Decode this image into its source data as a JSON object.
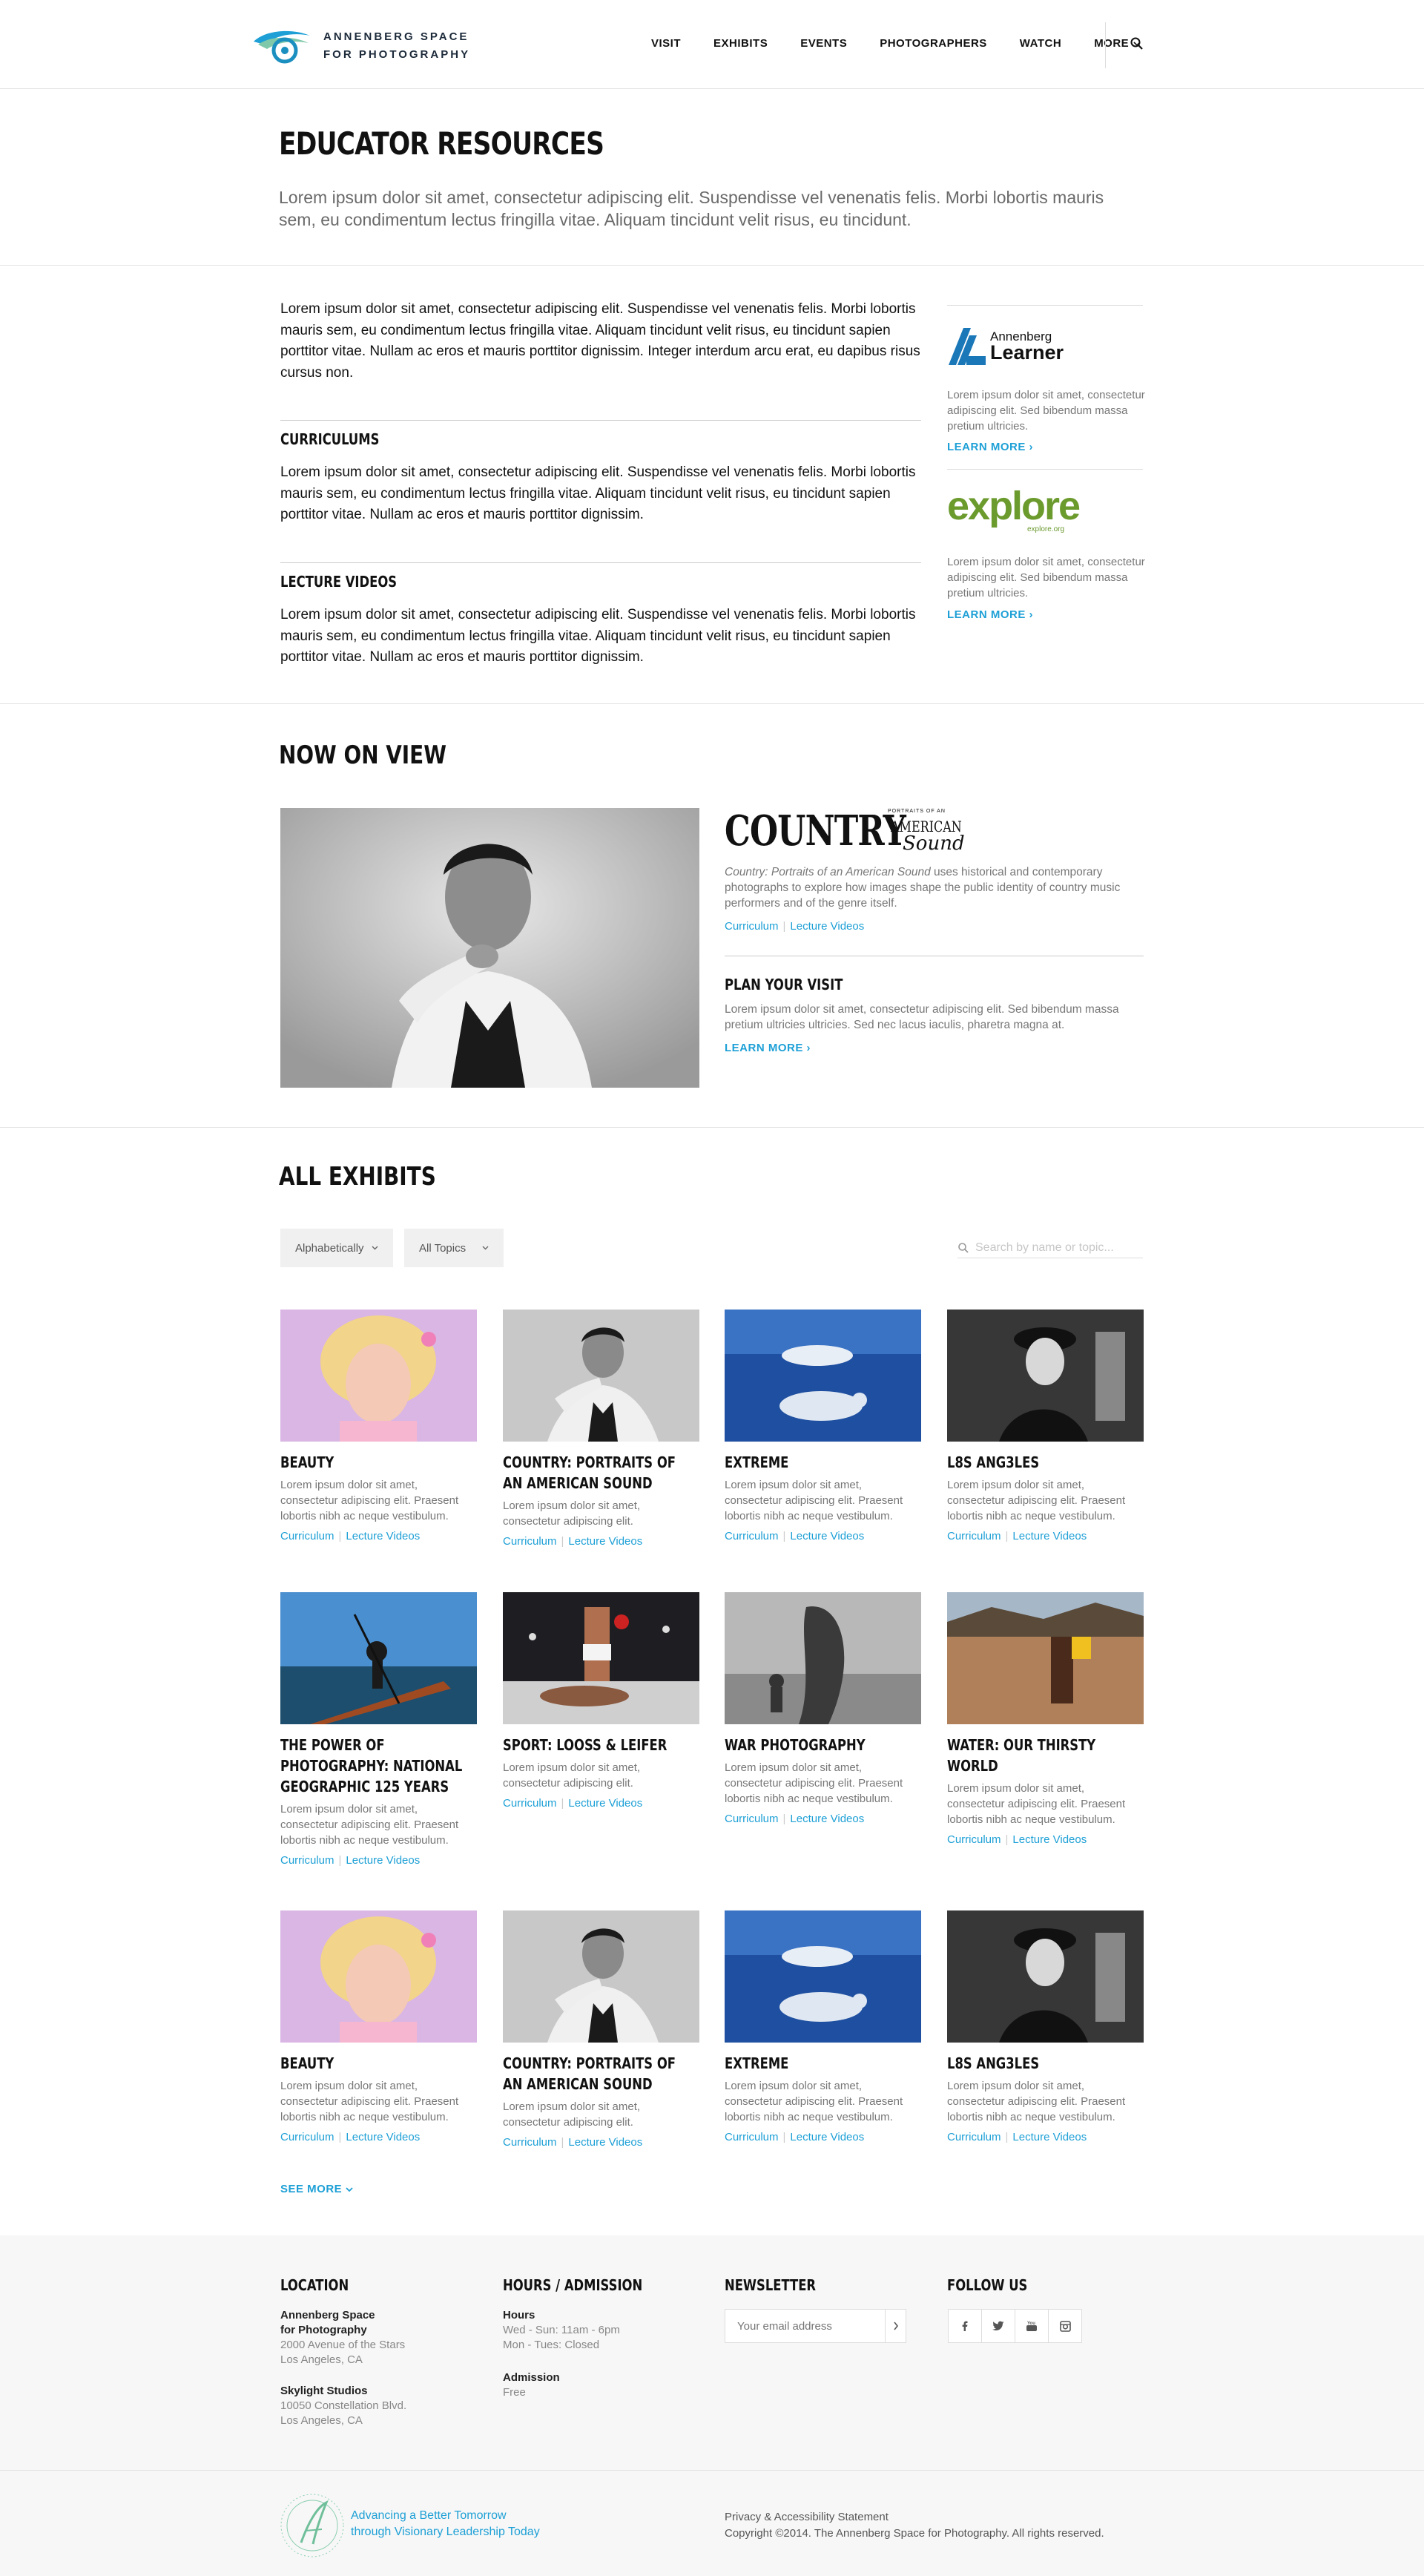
{
  "header": {
    "logo_line1": "Annenberg Space",
    "logo_line2": "for Photography",
    "nav": [
      "VISIT",
      "EXHIBITS",
      "EVENTS",
      "PHOTOGRAPHERS",
      "WATCH",
      "MORE"
    ],
    "search_icon": "search-icon"
  },
  "intro": {
    "title": "EDUCATOR RESOURCES",
    "text": "Lorem ipsum dolor sit amet, consectetur adipiscing elit. Suspendisse vel venenatis felis. Morbi lobortis mauris sem, eu condimentum lectus fringilla vitae. Aliquam tincidunt velit risus, eu tincidunt."
  },
  "resources": {
    "body": "Lorem ipsum dolor sit amet, consectetur adipiscing elit. Suspendisse vel venenatis felis. Morbi lobortis mauris sem, eu condimentum lectus fringilla vitae. Aliquam tincidunt velit risus, eu tincidunt sapien porttitor vitae. Nullam ac eros et mauris porttitor dignissim. Integer interdum arcu erat, eu dapibus risus cursus non.",
    "curriculums_title": "CURRICULUMS",
    "curriculums_text": "Lorem ipsum dolor sit amet, consectetur adipiscing elit. Suspendisse vel venenatis felis. Morbi lobortis mauris sem, eu condimentum lectus fringilla vitae. Aliquam tincidunt velit risus, eu tincidunt sapien porttitor vitae. Nullam ac eros et mauris porttitor dignissim.",
    "lectures_title": "LECTURE VIDEOS",
    "lectures_text": "Lorem ipsum dolor sit amet, consectetur adipiscing elit. Suspendisse vel venenatis felis. Morbi lobortis mauris sem, eu condimentum lectus fringilla vitae. Aliquam tincidunt velit risus, eu tincidunt sapien porttitor vitae. Nullam ac eros et mauris porttitor dignissim.",
    "sidebar": [
      {
        "logo_top": "Annenberg",
        "logo_bottom": "Learner",
        "text": "Lorem ipsum dolor sit amet, consectetur adipiscing elit. Sed bibendum massa pretium ultricies.",
        "link": "LEARN MORE ›"
      },
      {
        "logo": "explore",
        "logo_sub": "explore.org",
        "text": "Lorem ipsum dolor sit amet, consectetur adipiscing elit. Sed bibendum massa pretium ultricies.",
        "link": "LEARN MORE ›"
      }
    ]
  },
  "now_on_view": {
    "title": "NOW ON VIEW",
    "logo_main": "COUNTRY",
    "logo_small": "PORTRAITS OF AN",
    "logo_american": "AMERICAN",
    "logo_sound": "Sound",
    "desc_italic": "Country: Portraits of an American Sound",
    "desc_rest": " uses historical and contemporary photographs to explore how images shape the public identity of country music performers and of the genre itself.",
    "link1": "Curriculum",
    "link2": "Lecture Videos",
    "plan_title": "PLAN YOUR VISIT",
    "plan_text": "Lorem ipsum dolor sit amet, consectetur adipiscing elit. Sed bibendum massa pretium ultricies ultricies. Sed nec lacus iaculis, pharetra magna at.",
    "plan_link": "LEARN MORE ›"
  },
  "all_exhibits": {
    "title": "ALL EXHIBITS",
    "sort_label": "Alphabetically",
    "topic_label": "All Topics",
    "search_placeholder": "Search by name or topic...",
    "link1": "Curriculum",
    "link2": "Lecture Videos",
    "cards": [
      {
        "title": "BEAUTY",
        "desc": "Lorem ipsum dolor sit amet, consectetur adipiscing elit. Praesent lobortis nibh ac neque vestibulum.",
        "img": "beauty"
      },
      {
        "title": "COUNTRY: PORTRAITS OF AN AMERICAN SOUND",
        "desc": "Lorem ipsum dolor sit amet, consectetur adipiscing elit.",
        "img": "country"
      },
      {
        "title": "EXTREME",
        "desc": "Lorem ipsum dolor sit amet, consectetur adipiscing elit. Praesent lobortis nibh ac neque vestibulum.",
        "img": "extreme"
      },
      {
        "title": "L8S ANG3LES",
        "desc": "Lorem ipsum dolor sit amet, consectetur adipiscing elit. Praesent lobortis nibh ac neque vestibulum.",
        "img": "la"
      },
      {
        "title": "THE POWER OF PHOTOGRAPHY: NATIONAL GEOGRAPHIC 125 YEARS",
        "desc": "Lorem ipsum dolor sit amet, consectetur adipiscing elit. Praesent lobortis nibh ac neque vestibulum.",
        "img": "natgeo"
      },
      {
        "title": "SPORT: LOOSS & LEIFER",
        "desc": "Lorem ipsum dolor sit amet, consectetur adipiscing elit.",
        "img": "sport"
      },
      {
        "title": "WAR PHOTOGRAPHY",
        "desc": "Lorem ipsum dolor sit amet, consectetur adipiscing elit. Praesent lobortis nibh ac neque vestibulum.",
        "img": "war"
      },
      {
        "title": "WATER: OUR THIRSTY WORLD",
        "desc": "Lorem ipsum dolor sit amet, consectetur adipiscing elit. Praesent lobortis nibh ac neque vestibulum.",
        "img": "water"
      },
      {
        "title": "BEAUTY",
        "desc": "Lorem ipsum dolor sit amet, consectetur adipiscing elit. Praesent lobortis nibh ac neque vestibulum.",
        "img": "beauty"
      },
      {
        "title": "COUNTRY: PORTRAITS OF AN AMERICAN SOUND",
        "desc": "Lorem ipsum dolor sit amet, consectetur adipiscing elit.",
        "img": "country"
      },
      {
        "title": "EXTREME",
        "desc": "Lorem ipsum dolor sit amet, consectetur adipiscing elit. Praesent lobortis nibh ac neque vestibulum.",
        "img": "extreme"
      },
      {
        "title": "L8S ANG3LES",
        "desc": "Lorem ipsum dolor sit amet, consectetur adipiscing elit. Praesent lobortis nibh ac neque vestibulum.",
        "img": "la"
      }
    ],
    "see_more": "SEE MORE"
  },
  "footer": {
    "location_title": "LOCATION",
    "loc1_name1": "Annenberg Space",
    "loc1_name2": "for Photography",
    "loc1_addr1": "2000 Avenue of the Stars",
    "loc1_addr2": "Los Angeles, CA",
    "loc2_name": "Skylight Studios",
    "loc2_addr1": "10050 Constellation Blvd.",
    "loc2_addr2": "Los Angeles, CA",
    "hours_title": "HOURS / ADMISSION",
    "hours_label": "Hours",
    "hours_1": "Wed - Sun: 11am - 6pm",
    "hours_2": "Mon - Tues: Closed",
    "admission_label": "Admission",
    "admission_value": "Free",
    "newsletter_title": "NEWSLETTER",
    "newsletter_placeholder": "Your email address",
    "follow_title": "FOLLOW US",
    "social": [
      "facebook-icon",
      "twitter-icon",
      "youtube-icon",
      "instagram-icon"
    ],
    "tagline_1": "Advancing a Better Tomorrow",
    "tagline_2": "through Visionary Leadership Today",
    "legal_1": "Privacy & Accessibility Statement",
    "legal_2": "Copyright ©2014. The Annenberg Space for Photography. All rights reserved."
  },
  "colors": {
    "accent": "#1ea0d6",
    "learner_blue": "#1a77b8",
    "explore_green": "#6b9a2d",
    "footer_bg": "#f7f7f7"
  }
}
